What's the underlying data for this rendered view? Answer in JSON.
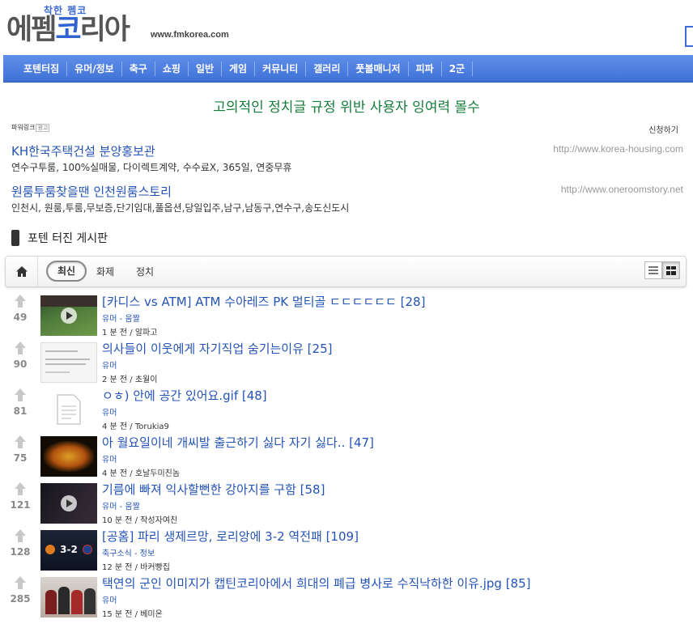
{
  "site": {
    "tagline": "착한 펨코",
    "logo_gray": "에펨",
    "logo_blue": "코",
    "logo_gray2": "리아",
    "url": "www.fmkorea.com"
  },
  "nav": [
    "포텐터짐",
    "유머/정보",
    "축구",
    "쇼핑",
    "일반",
    "게임",
    "커뮤니티",
    "갤러리",
    "풋볼매니저",
    "피파",
    "2군"
  ],
  "notice": "고의적인 정치글 규정 위반 사용자 잉여력 몰수",
  "ads": {
    "header": "파워링크",
    "badge": "광고",
    "apply": "신청하기",
    "items": [
      {
        "title": "KH한국주택건설 분양홍보관",
        "url": "http://www.korea-housing.com",
        "desc": "연수구투룸, 100%실매물, 다이렉트계약, 수수료X, 365일, 연중무휴"
      },
      {
        "title": "원룸투룸찾을땐 인천원룸스토리",
        "url": "http://www.oneroomstory.net",
        "desc": "인천시, 원룸,투룸,무보증,단기임대,풀옵션,당일입주,남구,남동구,연수구,송도신도시"
      }
    ]
  },
  "board": {
    "title": "포텐 터진 게시판",
    "tabs": [
      "최신",
      "화제",
      "정치"
    ]
  },
  "posts": [
    {
      "votes": "49",
      "title": "[카디스 vs ATM] ATM 수아레즈 PK 멀티골 ㄷㄷㄷㄷㄷㄷ [28]",
      "cat": "유머 - 움짤",
      "meta": "1 분 전 / 알파고",
      "thumb": "soccer-video"
    },
    {
      "votes": "90",
      "title": "의사들이 이웃에게 자기직업 숨기는이유 [25]",
      "cat": "유머",
      "meta": "2 분 전 / 초월이",
      "thumb": "text-screenshot"
    },
    {
      "votes": "81",
      "title": "ㅇㅎ) 안에 공간 있어요.gif [48]",
      "cat": "유머",
      "meta": "4 분 전 / Torukia9",
      "thumb": "document-placeholder"
    },
    {
      "votes": "75",
      "title": "아 월요일이네 개씨발 출근하기 싫다 자기 싫다.. [47]",
      "cat": "유머",
      "meta": "4 분 전 / 호날두미친놈",
      "thumb": "neon-text"
    },
    {
      "votes": "121",
      "title": "기름에 빠져 익사할뻔한 강아지를 구함 [58]",
      "cat": "유머 - 움짤",
      "meta": "10 분 전 / 작성자여친",
      "thumb": "dark-video"
    },
    {
      "votes": "128",
      "title": "[공홈] 파리 생제르망, 로리앙에 3-2 역전패 [109]",
      "cat": "축구소식 - 정보",
      "meta": "12 분 전 / 바커빵집",
      "thumb": "score-graphic",
      "score": "3-2"
    },
    {
      "votes": "285",
      "title": "택연의 군인 이미지가 캡틴코리아에서 희대의 폐급 병사로 수직낙하한 이유.jpg [85]",
      "cat": "유머",
      "meta": "15 분 전 / 베미온",
      "thumb": "group-photo"
    }
  ]
}
